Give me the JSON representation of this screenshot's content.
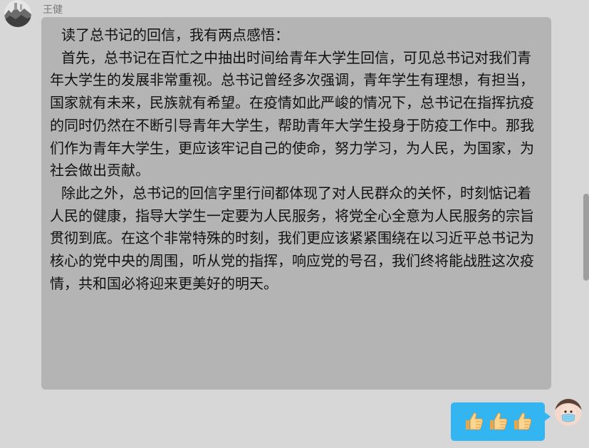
{
  "sender": {
    "name": "王健"
  },
  "message": {
    "paragraphs": [
      "读了总书记的回信，我有两点感悟：",
      "首先，总书记在百忙之中抽出时间给青年大学生回信，可见总书记对我们青年大学生的发展非常重视。总书记曾经多次强调，青年学生有理想，有担当，国家就有未来，民族就有希望。在疫情如此严峻的情况下，总书记在指挥抗疫的同时仍然在不断引导青年大学生，帮助青年大学生投身于防疫工作中。那我们作为青年大学生，更应该牢记自己的使命，努力学习，为人民，为国家，为社会做出贡献。",
      "除此之外，总书记的回信字里行间都体现了对人民群众的关怀，时刻惦记着人民的健康，指导大学生一定要为人民服务，将党全心全意为人民服务的宗旨贯彻到底。在这个非常特殊的时刻，我们更应该紧紧围绕在以习近平总书记为核心的党中央的周围，听从党的指挥，响应党的号召，我们终将能战胜这次疫情，共和国必将迎来更美好的明天。"
    ]
  },
  "reply": {
    "emoji_icons": [
      "thumbs-up-icon",
      "thumbs-up-icon",
      "thumbs-up-icon"
    ],
    "bubble_color": "#33b5f2"
  },
  "colors": {
    "background": "#d7d7d7",
    "incoming_bubble": "#b4b4b4"
  }
}
